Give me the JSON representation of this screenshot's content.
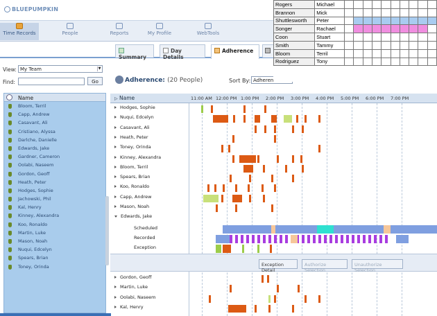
{
  "app": {
    "logo": "BLUEPUMPKIN",
    "nav": [
      {
        "label": "Time Records",
        "active": true
      },
      {
        "label": "People",
        "active": false
      },
      {
        "label": "Reports",
        "active": false
      },
      {
        "label": "My Profile",
        "active": false
      },
      {
        "label": "WebTools",
        "active": false
      }
    ]
  },
  "tabs": [
    {
      "label": "Summary"
    },
    {
      "label": "Day Details"
    },
    {
      "label": "Adherence"
    }
  ],
  "left": {
    "view_label": "View:",
    "view_value": "My Team",
    "find_label": "Find:",
    "find_value": "",
    "go_label": "Go",
    "table_header": "Name",
    "people": [
      "Bloom, Terril",
      "Capp, Andrew",
      "Casavant, Ali",
      "Cristiano, Alyssa",
      "Darlche, Danielle",
      "Edwards, Jake",
      "Gardner, Cameron",
      "Oolabi, Naseem",
      "Gordon, Geoff",
      "Heath, Peter",
      "Hodges, Sophie",
      "Jachowski, Phil",
      "Kal, Henry",
      "Kinney, Alexandra",
      "Koo, Ronaldo",
      "Martin, Luke",
      "Mason, Noah",
      "Nuqui, Edcelyn",
      "Spears, Brian",
      "Toney, Orinda"
    ]
  },
  "main": {
    "title": "Adherence:",
    "count": "(20 People)",
    "sort_label": "Sort By:",
    "sort_value": "Adheren...",
    "grid_header": "Name",
    "times": [
      "11:00 AM",
      "12:00 PM",
      "1:00 PM",
      "2:00 PM",
      "3:00 PM",
      "4:00 PM",
      "5:00 PM",
      "6:00 PM",
      "7:00 PM"
    ],
    "rows": [
      "Hodges, Sophie",
      "Nuqui, Edcelyn",
      "Casavant, Ali",
      "Heath, Peter",
      "Toney, Orinda",
      "Kinney, Alexandra",
      "Bloom, Terril",
      "Spears, Brian",
      "Koo, Ronaldo",
      "Capp, Andrew",
      "Mason, Noah",
      "Edwards, Jake"
    ],
    "sub_rows": [
      "Scheduled",
      "Recorded",
      "Exception"
    ],
    "rows_after": [
      "Gordon, Geoff",
      "Martin, Luke",
      "Oolabi, Naseem",
      "Kal, Henry"
    ],
    "actions": [
      {
        "label": "Exception Detail",
        "enabled": true
      },
      {
        "label": "Authorize Selection",
        "enabled": false
      },
      {
        "label": "Unauthorize Selection",
        "enabled": false
      }
    ]
  },
  "overlay_table": [
    {
      "last": "Rogers",
      "first": "Michael"
    },
    {
      "last": "Brannon",
      "first": "Mick"
    },
    {
      "last": "Shuttlesworth",
      "first": "Peter"
    },
    {
      "last": "Songer",
      "first": "Rachael"
    },
    {
      "last": "Coon",
      "first": "Stuart"
    },
    {
      "last": "Smith",
      "first": "Tammy"
    },
    {
      "last": "Bloom",
      "first": "Terril"
    },
    {
      "last": "Rodriguez",
      "first": "Tony"
    }
  ],
  "colors": {
    "orange": "#dc5a14",
    "green": "#9ccc4a",
    "light_green": "#c8e07a",
    "scheduled": "#7f9fe0",
    "recorded": "#a93de0",
    "peach": "#f6c79a",
    "teal": "#2fe0d0",
    "pink": "#f08ee0",
    "light_blue": "#a9ccf0"
  }
}
